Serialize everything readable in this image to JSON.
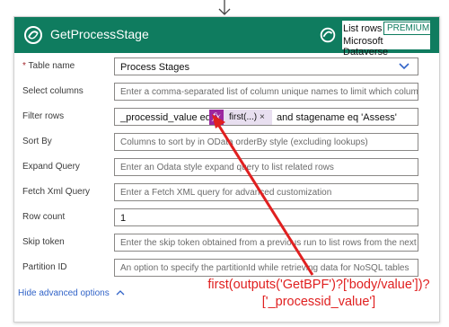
{
  "flow": {
    "action_title": "GetProcessStage",
    "connector_action": "List rows",
    "badge": "PREMIUM",
    "connector_name": "Microsoft Dataverse"
  },
  "fields": {
    "table_name": {
      "label": "Table name",
      "required_marker": "*",
      "value": "Process Stages"
    },
    "select_columns": {
      "label": "Select columns",
      "placeholder": "Enter a comma-separated list of column unique names to limit which columns a"
    },
    "filter_rows": {
      "label": "Filter rows",
      "text_before": "_processid_value eq",
      "token_label": "first(...)",
      "token_close": "×",
      "text_after": "and stagename eq 'Assess'"
    },
    "sort_by": {
      "label": "Sort By",
      "placeholder": "Columns to sort by in OData orderBy style (excluding lookups)"
    },
    "expand_query": {
      "label": "Expand Query",
      "placeholder": "Enter an Odata style expand query to list related rows"
    },
    "fetch_xml": {
      "label": "Fetch Xml Query",
      "placeholder": "Enter a Fetch XML query for advanced customization"
    },
    "row_count": {
      "label": "Row count",
      "value": "1"
    },
    "skip_token": {
      "label": "Skip token",
      "placeholder": "Enter the skip token obtained from a previous run to list rows from the next pag"
    },
    "partition_id": {
      "label": "Partition ID",
      "placeholder": "An option to specify the partitionId while retrieving data for NoSQL tables"
    }
  },
  "hide_advanced": "Hide advanced options",
  "annotation": {
    "line1": "first(outputs('GetBPF')?['body/value'])?",
    "line2": "['_processid_value']"
  },
  "colors": {
    "header_bg": "#0f7c5f",
    "token_fx": "#9c27a0",
    "annotation": "#e02020",
    "link": "#3264c8"
  },
  "icons": {
    "arrow": "arrow-down-icon",
    "dataverse": "dataverse-icon",
    "chevron": "chevron-down-icon",
    "function": "fx-icon"
  }
}
